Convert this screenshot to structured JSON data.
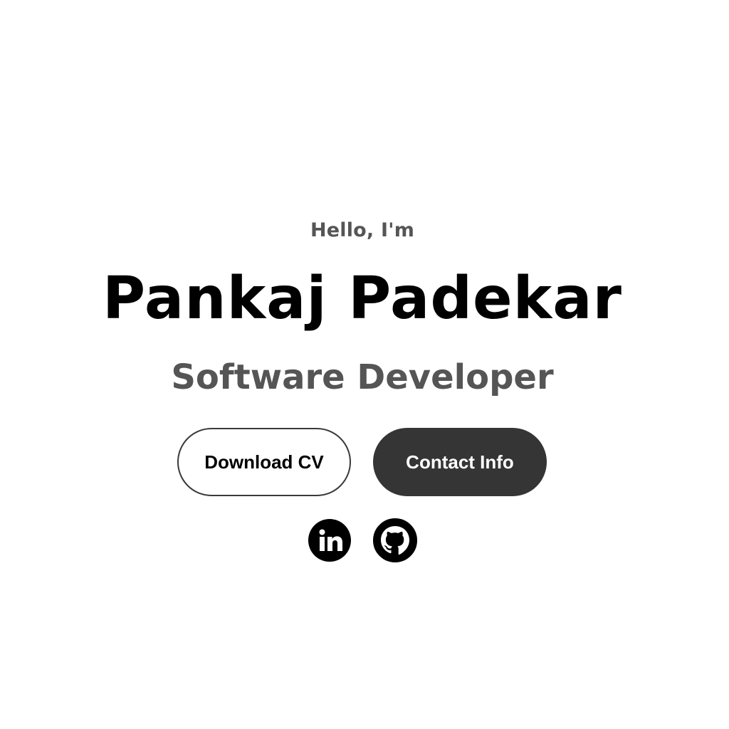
{
  "hero": {
    "greeting": "Hello, I'm",
    "name": "Pankaj Padekar",
    "role": "Software Developer"
  },
  "buttons": {
    "download_cv": "Download CV",
    "contact_info": "Contact Info"
  },
  "social": [
    {
      "name": "linkedin",
      "icon": "linkedin-icon"
    },
    {
      "name": "github",
      "icon": "github-icon"
    }
  ],
  "colors": {
    "background": "#ffffff",
    "primary_text": "#000000",
    "secondary_text": "#555555",
    "button_dark": "#353535"
  }
}
